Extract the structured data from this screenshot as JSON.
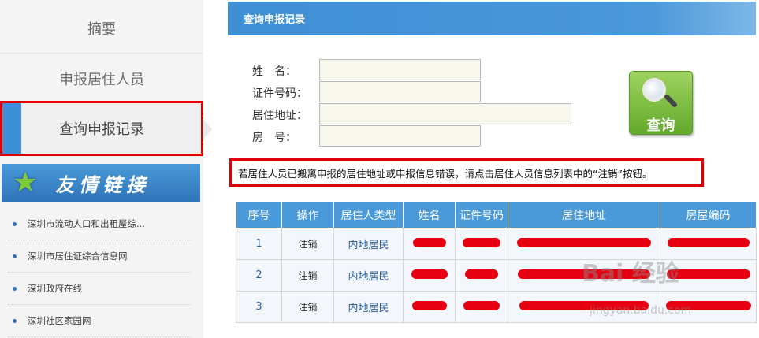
{
  "sidebar": {
    "items": [
      {
        "label": "摘要"
      },
      {
        "label": "申报居住人员"
      },
      {
        "label": "查询申报记录"
      }
    ],
    "links_title": "友情链接",
    "links": [
      "深圳市流动人口和出租屋综...",
      "深圳市居住证综合信息网",
      "深圳政府在线",
      "深圳社区家园网"
    ]
  },
  "panel": {
    "title": "查询申报记录"
  },
  "form": {
    "name_label": "姓　名：",
    "id_label": "证件号码：",
    "address_label": "居住地址：",
    "room_label": "房　号：",
    "name_value": "",
    "id_value": "",
    "address_value": "",
    "room_value": "",
    "query_button": "查询"
  },
  "notice": "若居住人员已搬离申报的居住地址或申报信息错误，请点击居住人员信息列表中的“注销”按钮。",
  "table": {
    "headers": [
      "序号",
      "操作",
      "居住人类型",
      "姓名",
      "证件号码",
      "居住地址",
      "房屋编码"
    ],
    "rows": [
      {
        "no": "1",
        "op": "注销",
        "type": "内地居民"
      },
      {
        "no": "2",
        "op": "注销",
        "type": "内地居民"
      },
      {
        "no": "3",
        "op": "注销",
        "type": "内地居民"
      }
    ]
  },
  "watermark": {
    "main": "Bai 经验",
    "sub": "jingyan.baidu.com"
  },
  "colors": {
    "accent_blue": "#4a99d9",
    "highlight_red": "#e00000",
    "button_green": "#7cbf45",
    "redaction": "#e60012"
  }
}
